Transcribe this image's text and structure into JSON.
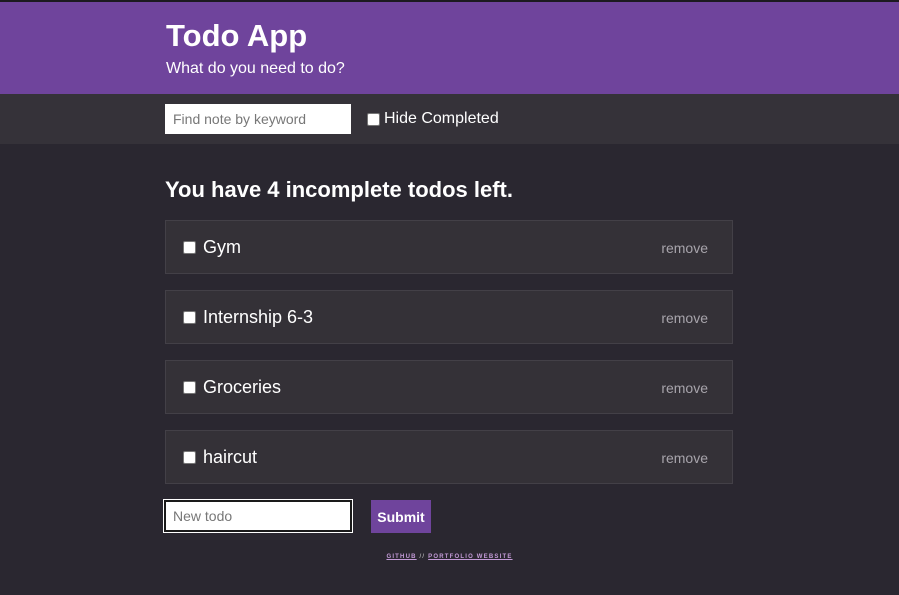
{
  "header": {
    "title": "Todo App",
    "subtitle": "What do you need to do?"
  },
  "filter": {
    "search_placeholder": "Find note by keyword",
    "hide_completed_label": "Hide Completed"
  },
  "summary": {
    "text": "You have 4 incomplete todos left."
  },
  "todos": [
    {
      "text": "Gym",
      "remove_label": "remove"
    },
    {
      "text": "Internship 6-3",
      "remove_label": "remove"
    },
    {
      "text": "Groceries",
      "remove_label": "remove"
    },
    {
      "text": "haircut",
      "remove_label": "remove"
    }
  ],
  "new_todo": {
    "placeholder": "New todo",
    "submit_label": "Submit"
  },
  "footer": {
    "github_label": "GITHUB",
    "separator": "//",
    "portfolio_label": "PORTFOLIO WEBSITE"
  },
  "colors": {
    "accent": "#6f449c",
    "background": "#2a2730",
    "filter_bar": "#353239",
    "card": "#343137"
  }
}
